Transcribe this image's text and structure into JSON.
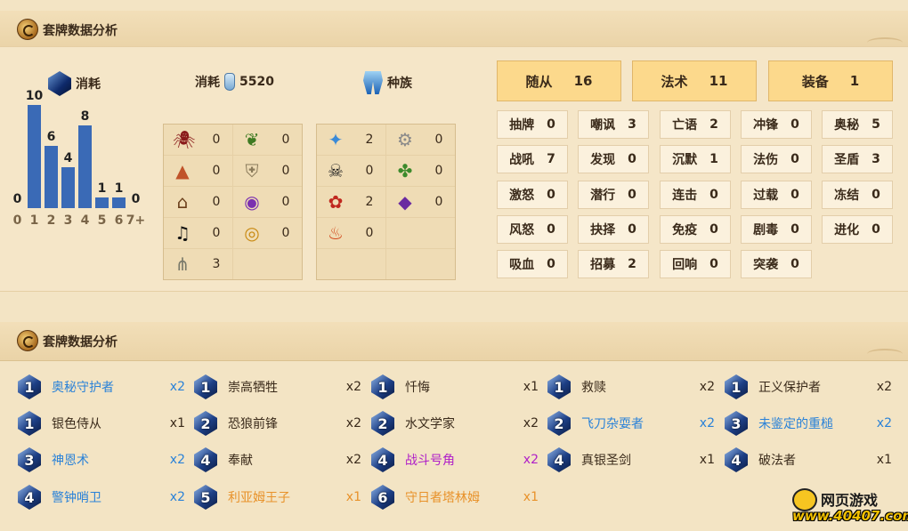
{
  "section1": {
    "title": "套牌数据分析"
  },
  "section2": {
    "title": "套牌数据分析"
  },
  "headers": {
    "cost_label": "消耗",
    "total_label": "消耗",
    "total_value": "5520",
    "race_label": "种族"
  },
  "chart_data": {
    "type": "bar",
    "categories": [
      "0",
      "1",
      "2",
      "3",
      "4",
      "5",
      "6",
      "7+"
    ],
    "values": [
      0,
      10,
      6,
      4,
      8,
      1,
      1,
      0
    ],
    "ylim": [
      0,
      10
    ],
    "color": "#3a6ab6"
  },
  "class_grid": [
    {
      "icon": "spider-icon",
      "value": "0"
    },
    {
      "icon": "leaf-icon",
      "value": "0"
    },
    {
      "icon": "mountain-icon",
      "value": "0"
    },
    {
      "icon": "shield-icon",
      "value": "0"
    },
    {
      "icon": "hat-icon",
      "value": "0"
    },
    {
      "icon": "purple-eye-icon",
      "value": "0"
    },
    {
      "icon": "music-note-icon",
      "value": "0"
    },
    {
      "icon": "gold-ring-icon",
      "value": "0"
    },
    {
      "icon": "claw-icon",
      "value": "3"
    }
  ],
  "race_grid": [
    {
      "icon": "murloc-icon",
      "value": "2"
    },
    {
      "icon": "gear-icon",
      "value": "0"
    },
    {
      "icon": "pirate-icon",
      "value": "0"
    },
    {
      "icon": "dragon-icon",
      "value": "0"
    },
    {
      "icon": "paw-icon",
      "value": "2"
    },
    {
      "icon": "demon-icon",
      "value": "0"
    },
    {
      "icon": "elemental-icon",
      "value": "0"
    }
  ],
  "types": [
    {
      "label": "随从",
      "value": "16"
    },
    {
      "label": "法术",
      "value": "11"
    },
    {
      "label": "装备",
      "value": "1"
    }
  ],
  "keywords": [
    {
      "label": "抽牌",
      "value": "0"
    },
    {
      "label": "嘲讽",
      "value": "3"
    },
    {
      "label": "亡语",
      "value": "2"
    },
    {
      "label": "冲锋",
      "value": "0"
    },
    {
      "label": "奥秘",
      "value": "5"
    },
    {
      "label": "战吼",
      "value": "7"
    },
    {
      "label": "发现",
      "value": "0"
    },
    {
      "label": "沉默",
      "value": "1"
    },
    {
      "label": "法伤",
      "value": "0"
    },
    {
      "label": "圣盾",
      "value": "3"
    },
    {
      "label": "激怒",
      "value": "0"
    },
    {
      "label": "潜行",
      "value": "0"
    },
    {
      "label": "连击",
      "value": "0"
    },
    {
      "label": "过载",
      "value": "0"
    },
    {
      "label": "冻结",
      "value": "0"
    },
    {
      "label": "风怒",
      "value": "0"
    },
    {
      "label": "抉择",
      "value": "0"
    },
    {
      "label": "免疫",
      "value": "0"
    },
    {
      "label": "剧毒",
      "value": "0"
    },
    {
      "label": "进化",
      "value": "0"
    },
    {
      "label": "吸血",
      "value": "0"
    },
    {
      "label": "招募",
      "value": "2"
    },
    {
      "label": "回响",
      "value": "0"
    },
    {
      "label": "突袭",
      "value": "0"
    }
  ],
  "colors": {
    "blue": "#2a82d8",
    "black": "#3a2a1a",
    "purple": "#b020c8",
    "orange": "#e8922a"
  },
  "cards": [
    {
      "cost": "1",
      "name": "奥秘守护者",
      "count": "x2",
      "color": "#2a82d8"
    },
    {
      "cost": "1",
      "name": "崇高牺牲",
      "count": "x2",
      "color": "#3a2a1a"
    },
    {
      "cost": "1",
      "name": "忏悔",
      "count": "x1",
      "color": "#3a2a1a"
    },
    {
      "cost": "1",
      "name": "救赎",
      "count": "x2",
      "color": "#3a2a1a"
    },
    {
      "cost": "1",
      "name": "正义保护者",
      "count": "x2",
      "color": "#3a2a1a"
    },
    {
      "cost": "1",
      "name": "银色侍从",
      "count": "x1",
      "color": "#3a2a1a"
    },
    {
      "cost": "2",
      "name": "恐狼前锋",
      "count": "x2",
      "color": "#3a2a1a"
    },
    {
      "cost": "2",
      "name": "水文学家",
      "count": "x2",
      "color": "#3a2a1a"
    },
    {
      "cost": "2",
      "name": "飞刀杂耍者",
      "count": "x2",
      "color": "#2a82d8"
    },
    {
      "cost": "3",
      "name": "未鉴定的重槌",
      "count": "x2",
      "color": "#2a82d8"
    },
    {
      "cost": "3",
      "name": "神恩术",
      "count": "x2",
      "color": "#2a82d8"
    },
    {
      "cost": "4",
      "name": "奉献",
      "count": "x2",
      "color": "#3a2a1a"
    },
    {
      "cost": "4",
      "name": "战斗号角",
      "count": "x2",
      "color": "#b020c8"
    },
    {
      "cost": "4",
      "name": "真银圣剑",
      "count": "x1",
      "color": "#3a2a1a"
    },
    {
      "cost": "4",
      "name": "破法者",
      "count": "x1",
      "color": "#3a2a1a"
    },
    {
      "cost": "4",
      "name": "警钟哨卫",
      "count": "x2",
      "color": "#2a82d8"
    },
    {
      "cost": "5",
      "name": "利亚姆王子",
      "count": "x1",
      "color": "#e8922a"
    },
    {
      "cost": "6",
      "name": "守日者塔林姆",
      "count": "x1",
      "color": "#e8922a"
    }
  ],
  "brand": {
    "line1": "网页游戏",
    "line2": "www.40407.com"
  }
}
